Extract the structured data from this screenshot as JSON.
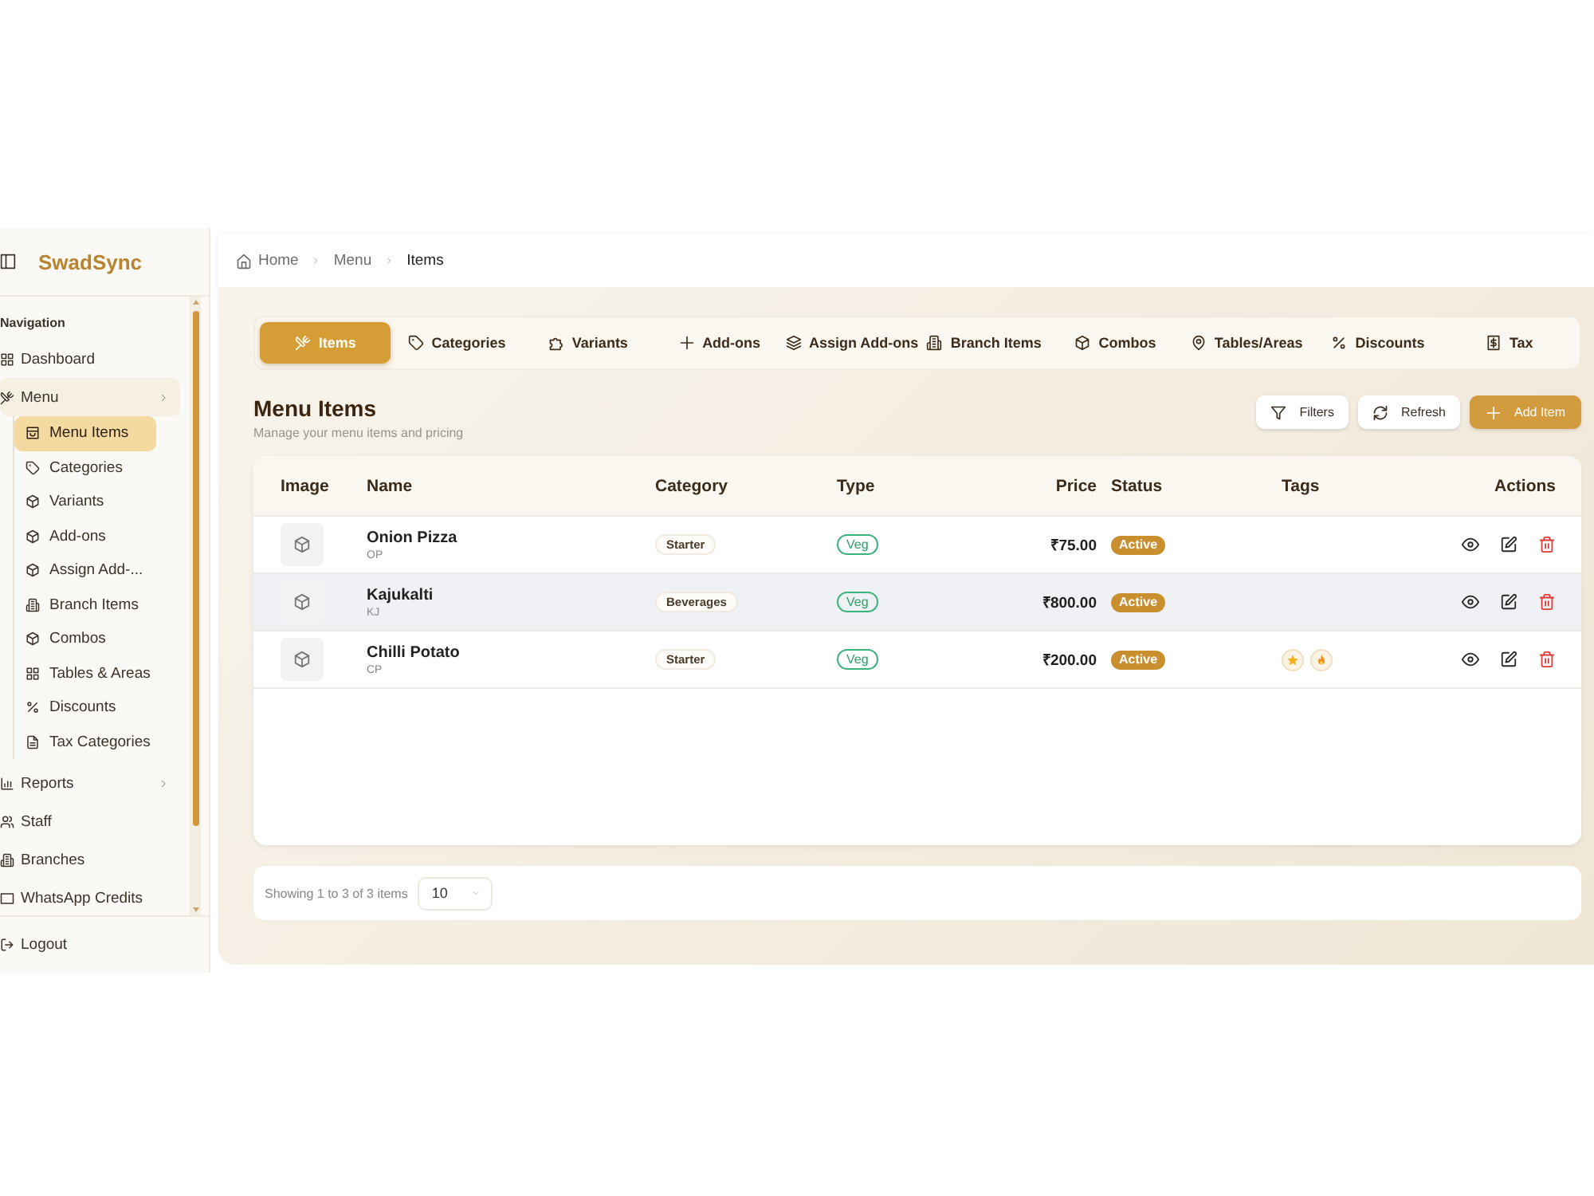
{
  "sidebar": {
    "brand": "SwadSync",
    "section_label": "Navigation",
    "items": [
      {
        "label": "Dashboard",
        "selected": false,
        "expandable": false
      },
      {
        "label": "Menu",
        "selected": true,
        "expandable": true,
        "children": [
          {
            "label": "Menu Items",
            "selected": true
          },
          {
            "label": "Categories",
            "selected": false
          },
          {
            "label": "Variants",
            "selected": false
          },
          {
            "label": "Add-ons",
            "selected": false
          },
          {
            "label": "Assign Add-...",
            "selected": false
          },
          {
            "label": "Branch Items",
            "selected": false
          },
          {
            "label": "Combos",
            "selected": false
          },
          {
            "label": "Tables & Areas",
            "selected": false
          },
          {
            "label": "Discounts",
            "selected": false
          },
          {
            "label": "Tax Categories",
            "selected": false
          }
        ]
      },
      {
        "label": "Reports",
        "selected": false,
        "expandable": true
      },
      {
        "label": "Staff",
        "selected": false,
        "expandable": false
      },
      {
        "label": "Branches",
        "selected": false,
        "expandable": false
      },
      {
        "label": "WhatsApp Credits",
        "selected": false,
        "expandable": false
      }
    ],
    "logout": "Logout"
  },
  "breadcrumb": [
    {
      "label": "Home",
      "current": false
    },
    {
      "label": "Menu",
      "current": false
    },
    {
      "label": "Items",
      "current": true
    }
  ],
  "tabs": [
    {
      "label": "Items",
      "selected": true
    },
    {
      "label": "Categories",
      "selected": false
    },
    {
      "label": "Variants",
      "selected": false
    },
    {
      "label": "Add-ons",
      "selected": false
    },
    {
      "label": "Assign Add-ons",
      "selected": false
    },
    {
      "label": "Branch Items",
      "selected": false
    },
    {
      "label": "Combos",
      "selected": false
    },
    {
      "label": "Tables/Areas",
      "selected": false
    },
    {
      "label": "Discounts",
      "selected": false
    },
    {
      "label": "Tax",
      "selected": false
    }
  ],
  "page": {
    "title": "Menu Items",
    "subtitle": "Manage your menu items and pricing"
  },
  "actions": [
    {
      "label": "Filters",
      "primary": false
    },
    {
      "label": "Refresh",
      "primary": false
    },
    {
      "label": "Add Item",
      "primary": true
    }
  ],
  "table": {
    "columns": [
      "Image",
      "Name",
      "Category",
      "Type",
      "Price",
      "Status",
      "Tags",
      "Actions"
    ],
    "rows": [
      {
        "name": "Onion Pizza",
        "code": "OP",
        "category": "Starter",
        "type": "Veg",
        "price": "₹75.00",
        "status": "Active",
        "highlighted": false
      },
      {
        "name": "Kajukalti",
        "code": "KJ",
        "category": "Beverages",
        "type": "Veg",
        "price": "₹800.00",
        "status": "Active",
        "highlighted": true
      },
      {
        "name": "Chilli Potato",
        "code": "CP",
        "category": "Starter",
        "type": "Veg",
        "price": "₹200.00",
        "status": "Active",
        "highlighted": false,
        "tags": [
          {
            "kind": "star"
          },
          {
            "kind": "flame"
          }
        ]
      }
    ]
  },
  "pagination": {
    "summary": "Showing 1 to 3 of 3 items",
    "page_size": "10"
  }
}
